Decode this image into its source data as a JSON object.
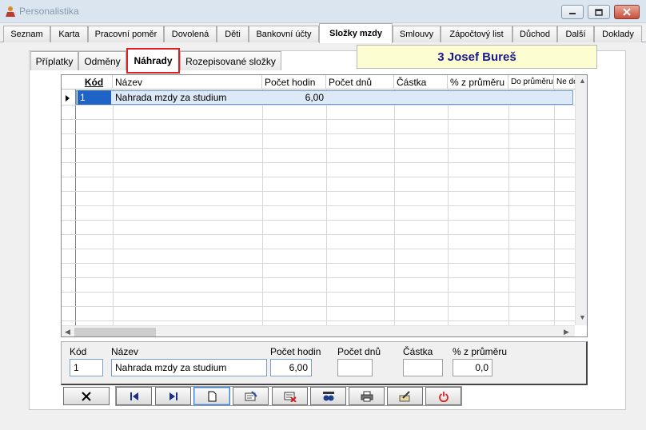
{
  "window": {
    "title": "Personalistika",
    "accent": "#1f63c6",
    "close_color": "#c9503a"
  },
  "main_tabs": [
    {
      "label": "Seznam"
    },
    {
      "label": "Karta"
    },
    {
      "label": "Pracovní poměr"
    },
    {
      "label": "Dovolená"
    },
    {
      "label": "Děti"
    },
    {
      "label": "Bankovní účty"
    },
    {
      "label": "Složky mzdy",
      "active": true
    },
    {
      "label": "Smlouvy"
    },
    {
      "label": "Zápočtový list"
    },
    {
      "label": "Důchod"
    },
    {
      "label": "Další"
    },
    {
      "label": "Doklady"
    }
  ],
  "sub_tabs": [
    {
      "label": "Příplatky"
    },
    {
      "label": "Odměny"
    },
    {
      "label": "Náhrady",
      "active": true
    },
    {
      "label": "Rozepisované složky"
    }
  ],
  "employee": {
    "display": "3 Josef Bureš"
  },
  "grid": {
    "columns": [
      "Kód",
      "Název",
      "Počet hodin",
      "Počet dnů",
      "Částka",
      "% z průměru",
      "Do průměru",
      "Ne do"
    ],
    "rows": [
      {
        "kod": "1",
        "nazev": "Nahrada mzdy za studium",
        "pocet_hodin": "6,00",
        "pocet_dnu": "",
        "castka": "",
        "procento": "",
        "do_prumeru": "",
        "ne_do": ""
      }
    ]
  },
  "detail": {
    "labels": {
      "kod": "Kód",
      "nazev": "Název",
      "pocet_hodin": "Počet hodin",
      "pocet_dnu": "Počet dnů",
      "castka": "Částka",
      "procento": "% z průměru"
    },
    "values": {
      "kod": "1",
      "nazev": "Nahrada mzdy za studium",
      "pocet_hodin": "6,00",
      "pocet_dnu": "",
      "castka": "",
      "procento": "0,0"
    }
  },
  "toolbar": {
    "buttons": [
      "cancel-icon",
      "first-record-icon",
      "last-record-icon",
      "new-record-icon",
      "edit-record-icon",
      "delete-record-icon",
      "search-icon",
      "print-icon",
      "export-icon",
      "power-icon"
    ]
  }
}
